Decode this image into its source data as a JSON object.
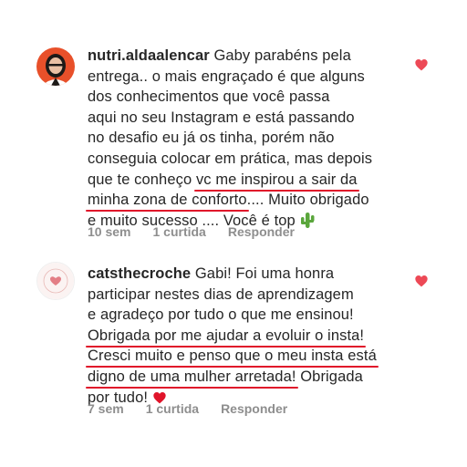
{
  "comments": [
    {
      "username": "nutri.aldaalencar",
      "lines": [
        "Gaby parabéns pela",
        "entrega.. o mais engraçado é que alguns",
        "dos conhecimentos que você passa",
        "aqui no seu Instagram e está passando",
        "no desafio eu já os tinha, porém não",
        "conseguia colocar em prática, mas depois",
        "que te conheço ",
        "vc me inspirou a sair da",
        "minha zona de conforto",
        ".... Muito obrigado",
        "e muito sucesso .... Você é top"
      ],
      "emoji": "cactus-emoji",
      "time": "10 sem",
      "likes": "1 curtida",
      "reply": "Responder",
      "heart_color": "#ed4956"
    },
    {
      "username": "catsthecroche",
      "lines": [
        "Gabi! Foi uma honra",
        "participar nestes dias de aprendizagem",
        "e agradeço por tudo o que me ensinou!",
        "Obrigada por me ajudar a evoluir o insta!",
        "Cresci muito e penso que o meu insta está",
        "digno de uma mulher arretada!",
        " Obrigada",
        "por tudo!"
      ],
      "emoji": "red-heart-emoji",
      "time": "7 sem",
      "likes": "1 curtida",
      "reply": "Responder",
      "heart_color": "#ed4956"
    }
  ],
  "colors": {
    "underline": "#e0142a",
    "meta": "#8e8e8e",
    "text": "#262626"
  }
}
